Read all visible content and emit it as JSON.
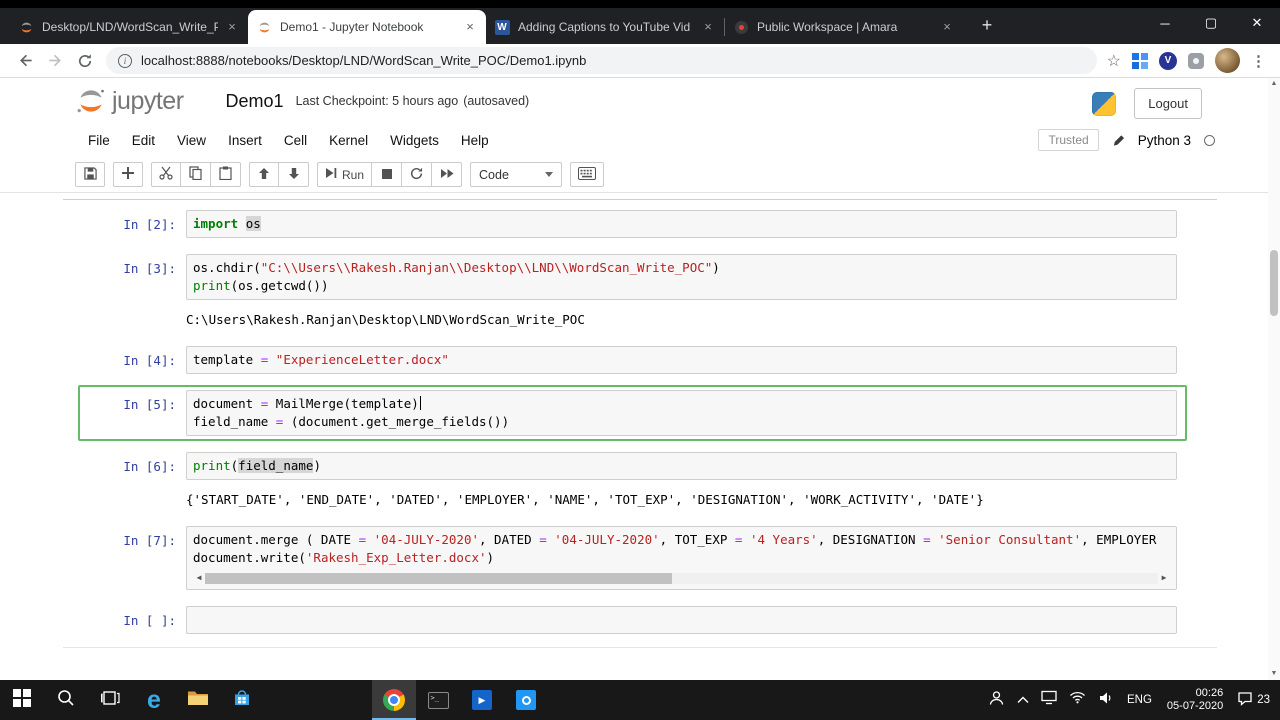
{
  "browser": {
    "tabs": [
      {
        "title": "Desktop/LND/WordScan_Write_P",
        "icon": "jupyter",
        "active": false
      },
      {
        "title": "Demo1 - Jupyter Notebook",
        "icon": "jupyter",
        "active": true
      },
      {
        "title": "Adding Captions to YouTube Vid",
        "icon": "word",
        "active": false
      },
      {
        "title": "Public Workspace | Amara",
        "icon": "amara",
        "active": false
      }
    ],
    "url": "localhost:8888/notebooks/Desktop/LND/WordScan_Write_POC/Demo1.ipynb",
    "nav_icons": [
      "back",
      "forward",
      "reload"
    ],
    "action_icons": [
      "bookmark-star",
      "grid-extension",
      "v-extension",
      "extension",
      "profile-avatar",
      "chrome-menu"
    ],
    "window_controls": [
      "minimize",
      "maximize",
      "close"
    ]
  },
  "header": {
    "logo_text": "jupyter",
    "title": "Demo1",
    "checkpoint": "Last Checkpoint: 5 hours ago",
    "autosave": "(autosaved)",
    "logout_label": "Logout"
  },
  "menu": {
    "items": [
      "File",
      "Edit",
      "View",
      "Insert",
      "Cell",
      "Kernel",
      "Widgets",
      "Help"
    ],
    "trusted_label": "Trusted",
    "kernel_label": "Python 3"
  },
  "toolbar": {
    "run_label": "Run",
    "cell_type": "Code",
    "buttons": [
      "save",
      "insert-cell-below",
      "cut-cells",
      "copy-cells",
      "paste-cells",
      "move-cell-up",
      "move-cell-down",
      "run",
      "interrupt-kernel",
      "restart-kernel",
      "restart-run-all",
      "keyboard-palette"
    ]
  },
  "cells": [
    {
      "prompt": "In [2]:",
      "selected": false,
      "lines": [
        [
          {
            "t": "kw",
            "v": "import"
          },
          {
            "t": "p",
            "v": " "
          },
          {
            "t": "hl",
            "v": "os"
          }
        ]
      ],
      "output": null
    },
    {
      "prompt": "In [3]:",
      "selected": false,
      "lines": [
        [
          {
            "t": "p",
            "v": "os.chdir("
          },
          {
            "t": "str",
            "v": "\"C:\\\\Users\\\\Rakesh.Ranjan\\\\Desktop\\\\LND\\\\WordScan_Write_POC\""
          },
          {
            "t": "p",
            "v": ")"
          }
        ],
        [
          {
            "t": "fn",
            "v": "print"
          },
          {
            "t": "p",
            "v": "(os.getcwd())"
          }
        ]
      ],
      "output": "C:\\Users\\Rakesh.Ranjan\\Desktop\\LND\\WordScan_Write_POC"
    },
    {
      "prompt": "In [4]:",
      "selected": false,
      "lines": [
        [
          {
            "t": "p",
            "v": "template "
          },
          {
            "t": "op",
            "v": "="
          },
          {
            "t": "p",
            "v": " "
          },
          {
            "t": "str",
            "v": "\"ExperienceLetter.docx\""
          }
        ]
      ],
      "output": null
    },
    {
      "prompt": "In [5]:",
      "selected": true,
      "lines": [
        [
          {
            "t": "p",
            "v": "document "
          },
          {
            "t": "op",
            "v": "="
          },
          {
            "t": "p",
            "v": " MailMerge(template)"
          },
          {
            "t": "cur",
            "v": ""
          }
        ],
        [
          {
            "t": "p",
            "v": "field_name "
          },
          {
            "t": "op",
            "v": "="
          },
          {
            "t": "p",
            "v": " (document.get_merge_fields())"
          }
        ]
      ],
      "output": null
    },
    {
      "prompt": "In [6]:",
      "selected": false,
      "lines": [
        [
          {
            "t": "fn",
            "v": "print"
          },
          {
            "t": "p",
            "v": "("
          },
          {
            "t": "hl",
            "v": "field_name"
          },
          {
            "t": "p",
            "v": ")"
          }
        ]
      ],
      "output": "{'START_DATE', 'END_DATE', 'DATED', 'EMPLOYER', 'NAME', 'TOT_EXP', 'DESIGNATION', 'WORK_ACTIVITY', 'DATE'}"
    },
    {
      "prompt": "In [7]:",
      "selected": false,
      "hscroll": true,
      "lines": [
        [
          {
            "t": "p",
            "v": "document.merge ( DATE "
          },
          {
            "t": "op",
            "v": "="
          },
          {
            "t": "p",
            "v": " "
          },
          {
            "t": "str",
            "v": "'04-JULY-2020'"
          },
          {
            "t": "p",
            "v": ", DATED "
          },
          {
            "t": "op",
            "v": "="
          },
          {
            "t": "p",
            "v": " "
          },
          {
            "t": "str",
            "v": "'04-JULY-2020'"
          },
          {
            "t": "p",
            "v": ", TOT_EXP "
          },
          {
            "t": "op",
            "v": "="
          },
          {
            "t": "p",
            "v": " "
          },
          {
            "t": "str",
            "v": "'4 Years'"
          },
          {
            "t": "p",
            "v": ", DESIGNATION "
          },
          {
            "t": "op",
            "v": "="
          },
          {
            "t": "p",
            "v": " "
          },
          {
            "t": "str",
            "v": "'Senior Consultant'"
          },
          {
            "t": "p",
            "v": ", EMPLOYER"
          }
        ],
        [
          {
            "t": "p",
            "v": "document.write("
          },
          {
            "t": "str",
            "v": "'Rakesh_Exp_Letter.docx'"
          },
          {
            "t": "p",
            "v": ")"
          }
        ]
      ],
      "output": null
    },
    {
      "prompt": "In [ ]:",
      "selected": false,
      "lines": [
        []
      ],
      "output": null
    }
  ],
  "taskbar": {
    "pinned": [
      "start",
      "search",
      "task-view",
      "edge",
      "file-explorer",
      "store",
      "chrome",
      "cmd",
      "movies",
      "photos"
    ],
    "active_app": "chrome",
    "tray_icons": [
      "people",
      "chevron-up",
      "monitor",
      "wifi",
      "volume"
    ],
    "language": "ENG",
    "time": "00:26",
    "date": "05-07-2020",
    "notification_count": "23"
  }
}
